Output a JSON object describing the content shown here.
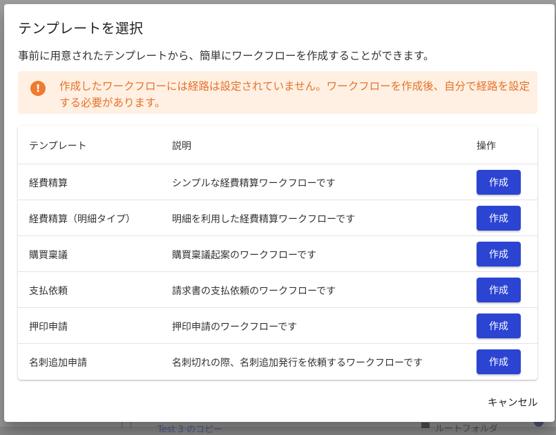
{
  "background": {
    "link_text": "Test 3 のコピー",
    "folder_text": "ルートフォルダ"
  },
  "dialog": {
    "title": "テンプレートを選択",
    "description": "事前に用意されたテンプレートから、簡単にワークフローを作成することができます。",
    "alert": {
      "icon": "!",
      "text": "作成したワークフローには経路は設定されていません。ワークフローを作成後、自分で経路を設定する必要があります。",
      "color": "#e4722a",
      "background": "#fff0e3"
    },
    "table": {
      "headers": [
        "テンプレート",
        "説明",
        "操作"
      ],
      "rows": [
        {
          "template": "経費精算",
          "description": "シンプルな経費精算ワークフローです",
          "action": "作成"
        },
        {
          "template": "経費精算（明細タイプ）",
          "description": "明細を利用した経費精算ワークフローです",
          "action": "作成"
        },
        {
          "template": "購買稟議",
          "description": "購買稟議起案のワークフローです",
          "action": "作成"
        },
        {
          "template": "支払依頼",
          "description": "請求書の支払依頼のワークフローです",
          "action": "作成"
        },
        {
          "template": "押印申請",
          "description": "押印申請のワークフローです",
          "action": "作成"
        },
        {
          "template": "名刺追加申請",
          "description": "名刺切れの際、名刺追加発行を依頼するワークフローです",
          "action": "作成"
        }
      ]
    },
    "cancel_label": "キャンセル",
    "primary_color": "#2b44d2"
  }
}
